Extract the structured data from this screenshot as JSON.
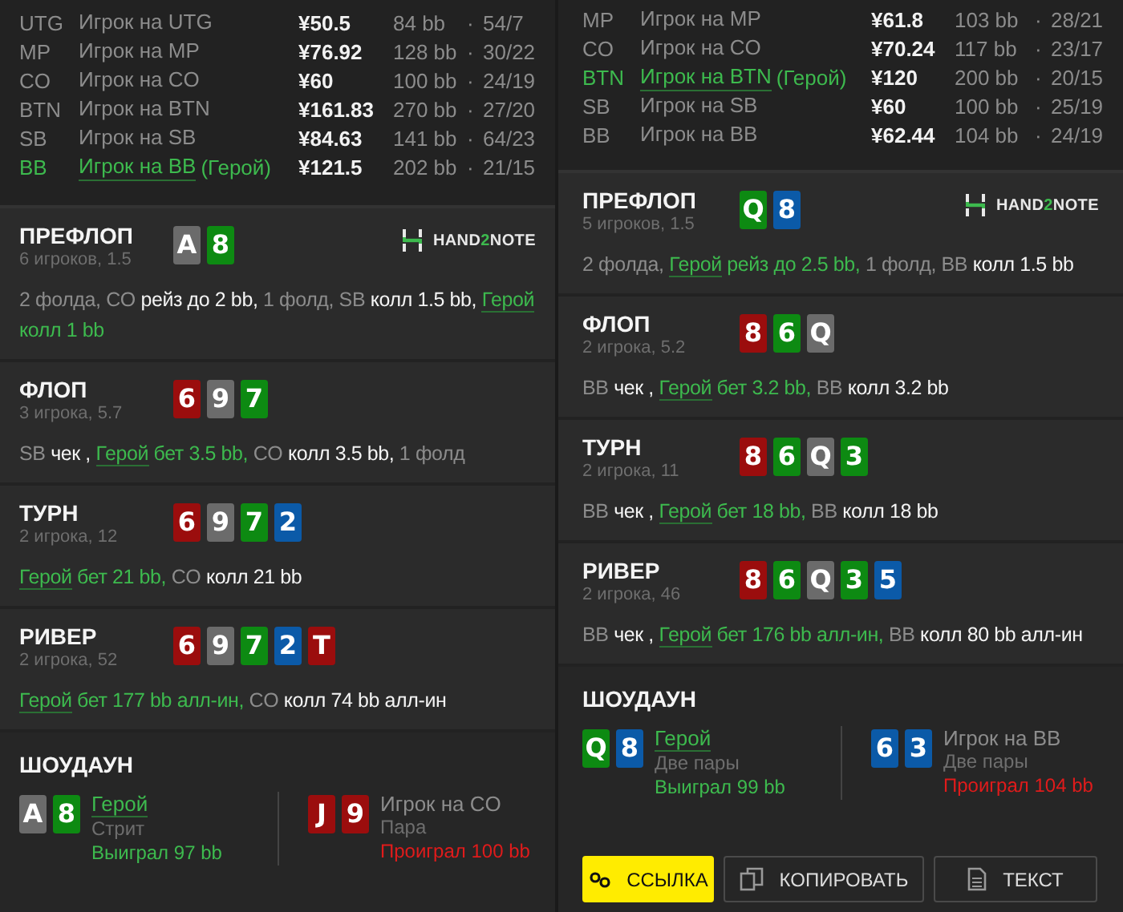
{
  "panels": [
    {
      "players": [
        {
          "pos": "UTG",
          "name": "Игрок на UTG",
          "hero": false,
          "stack": "¥50.5",
          "bb": "84 bb",
          "dot": "·",
          "stats": "54/7"
        },
        {
          "pos": "MP",
          "name": "Игрок на MP",
          "hero": false,
          "stack": "¥76.92",
          "bb": "128 bb",
          "dot": "·",
          "stats": "30/22"
        },
        {
          "pos": "CO",
          "name": "Игрок на CO",
          "hero": false,
          "stack": "¥60",
          "bb": "100 bb",
          "dot": "·",
          "stats": "24/19"
        },
        {
          "pos": "BTN",
          "name": "Игрок на BTN",
          "hero": false,
          "stack": "¥161.83",
          "bb": "270 bb",
          "dot": "·",
          "stats": "27/20"
        },
        {
          "pos": "SB",
          "name": "Игрок на SB",
          "hero": false,
          "stack": "¥84.63",
          "bb": "141 bb",
          "dot": "·",
          "stats": "64/23"
        },
        {
          "pos": "BB",
          "name": "Игрок на BB",
          "hero": true,
          "hero_tag": "(Герой)",
          "stack": "¥121.5",
          "bb": "202 bb",
          "dot": "·",
          "stats": "21/15"
        }
      ],
      "streets": [
        {
          "title": "ПРЕФЛОП",
          "sub": "6 игроков, 1.5",
          "logo": {
            "pre": "HAND",
            "mid": "2",
            "post": "NOTE"
          },
          "cards": [
            {
              "rank": "A",
              "color": "#6b6b6b"
            },
            {
              "rank": "8",
              "color": "#0d8a12"
            }
          ],
          "actions": [
            {
              "text": "2 фолда, CO ",
              "kind": "muted"
            },
            {
              "text": "рейз до 2 bb,",
              "kind": "strong"
            },
            {
              "text": " 1 фолд, SB ",
              "kind": "muted"
            },
            {
              "text": "колл 1.5 bb, ",
              "kind": "strong"
            },
            {
              "text": "Герой",
              "kind": "hero"
            },
            {
              "text": " колл 1 bb",
              "kind": "heroact"
            }
          ]
        },
        {
          "title": "ФЛОП",
          "sub": "3 игрока, 5.7",
          "cards": [
            {
              "rank": "6",
              "color": "#9b0d0d"
            },
            {
              "rank": "9",
              "color": "#6b6b6b"
            },
            {
              "rank": "7",
              "color": "#0d8a12"
            }
          ],
          "actions": [
            {
              "text": "SB ",
              "kind": "muted"
            },
            {
              "text": "чек , ",
              "kind": "strong"
            },
            {
              "text": "Герой",
              "kind": "hero"
            },
            {
              "text": " бет 3.5 bb,",
              "kind": "heroact"
            },
            {
              "text": " CO ",
              "kind": "muted"
            },
            {
              "text": "колл 3.5 bb,",
              "kind": "strong"
            },
            {
              "text": " 1 фолд",
              "kind": "muted"
            }
          ]
        },
        {
          "title": "ТУРН",
          "sub": "2 игрока, 12",
          "cards": [
            {
              "rank": "6",
              "color": "#9b0d0d"
            },
            {
              "rank": "9",
              "color": "#6b6b6b"
            },
            {
              "rank": "7",
              "color": "#0d8a12"
            },
            {
              "rank": "2",
              "color": "#0b5aa8"
            }
          ],
          "actions": [
            {
              "text": "Герой",
              "kind": "hero"
            },
            {
              "text": " бет 21 bb,",
              "kind": "heroact"
            },
            {
              "text": " CO ",
              "kind": "muted"
            },
            {
              "text": "колл 21 bb",
              "kind": "strong"
            }
          ]
        },
        {
          "title": "РИВЕР",
          "sub": "2 игрока, 52",
          "cards": [
            {
              "rank": "6",
              "color": "#9b0d0d"
            },
            {
              "rank": "9",
              "color": "#6b6b6b"
            },
            {
              "rank": "7",
              "color": "#0d8a12"
            },
            {
              "rank": "2",
              "color": "#0b5aa8"
            },
            {
              "rank": "T",
              "color": "#9b0d0d"
            }
          ],
          "actions": [
            {
              "text": "Герой",
              "kind": "hero"
            },
            {
              "text": " бет 177 bb алл-ин,",
              "kind": "heroact"
            },
            {
              "text": " CO ",
              "kind": "muted"
            },
            {
              "text": "колл 74 bb алл-ин",
              "kind": "strong"
            }
          ]
        }
      ],
      "showdown": {
        "title": "ШОУДАУН",
        "entries": [
          {
            "cards": [
              {
                "rank": "A",
                "color": "#6b6b6b"
              },
              {
                "rank": "8",
                "color": "#0d8a12"
              }
            ],
            "name": "Герой",
            "hero": true,
            "hand": "Стрит",
            "result": "Выиграл 97 bb",
            "won": true
          },
          {
            "cards": [
              {
                "rank": "J",
                "color": "#9b0d0d"
              },
              {
                "rank": "9",
                "color": "#9b0d0d"
              }
            ],
            "name": "Игрок на CO",
            "hero": false,
            "hand": "Пара",
            "result": "Проиграл 100 bb",
            "won": false
          }
        ]
      }
    },
    {
      "players": [
        {
          "pos": "MP",
          "name": "Игрок на MP",
          "hero": false,
          "stack": "¥61.8",
          "bb": "103 bb",
          "dot": "·",
          "stats": "28/21"
        },
        {
          "pos": "CO",
          "name": "Игрок на CO",
          "hero": false,
          "stack": "¥70.24",
          "bb": "117 bb",
          "dot": "·",
          "stats": "23/17"
        },
        {
          "pos": "BTN",
          "name": "Игрок на BTN",
          "hero": true,
          "hero_tag": "(Герой)",
          "stack": "¥120",
          "bb": "200 bb",
          "dot": "·",
          "stats": "20/15"
        },
        {
          "pos": "SB",
          "name": "Игрок на SB",
          "hero": false,
          "stack": "¥60",
          "bb": "100 bb",
          "dot": "·",
          "stats": "25/19"
        },
        {
          "pos": "BB",
          "name": "Игрок на BB",
          "hero": false,
          "stack": "¥62.44",
          "bb": "104 bb",
          "dot": "·",
          "stats": "24/19"
        }
      ],
      "streets": [
        {
          "title": "ПРЕФЛОП",
          "sub": "5 игроков, 1.5",
          "logo": {
            "pre": "HAND",
            "mid": "2",
            "post": "NOTE"
          },
          "cards": [
            {
              "rank": "Q",
              "color": "#0d8a12"
            },
            {
              "rank": "8",
              "color": "#0b5aa8"
            }
          ],
          "actions": [
            {
              "text": "2 фолда, ",
              "kind": "muted"
            },
            {
              "text": "Герой",
              "kind": "hero"
            },
            {
              "text": " рейз до 2.5 bb,",
              "kind": "heroact"
            },
            {
              "text": " 1 фолд, BB ",
              "kind": "muted"
            },
            {
              "text": "колл 1.5 bb",
              "kind": "strong"
            }
          ]
        },
        {
          "title": "ФЛОП",
          "sub": "2 игрока, 5.2",
          "cards": [
            {
              "rank": "8",
              "color": "#9b0d0d"
            },
            {
              "rank": "6",
              "color": "#0d8a12"
            },
            {
              "rank": "Q",
              "color": "#6b6b6b"
            }
          ],
          "actions": [
            {
              "text": "BB ",
              "kind": "muted"
            },
            {
              "text": "чек , ",
              "kind": "strong"
            },
            {
              "text": "Герой",
              "kind": "hero"
            },
            {
              "text": " бет 3.2 bb,",
              "kind": "heroact"
            },
            {
              "text": " BB ",
              "kind": "muted"
            },
            {
              "text": "колл 3.2 bb",
              "kind": "strong"
            }
          ]
        },
        {
          "title": "ТУРН",
          "sub": "2 игрока, 11",
          "cards": [
            {
              "rank": "8",
              "color": "#9b0d0d"
            },
            {
              "rank": "6",
              "color": "#0d8a12"
            },
            {
              "rank": "Q",
              "color": "#6b6b6b"
            },
            {
              "rank": "3",
              "color": "#0d8a12"
            }
          ],
          "actions": [
            {
              "text": "BB ",
              "kind": "muted"
            },
            {
              "text": "чек , ",
              "kind": "strong"
            },
            {
              "text": "Герой",
              "kind": "hero"
            },
            {
              "text": " бет 18 bb,",
              "kind": "heroact"
            },
            {
              "text": " BB ",
              "kind": "muted"
            },
            {
              "text": "колл 18 bb",
              "kind": "strong"
            }
          ]
        },
        {
          "title": "РИВЕР",
          "sub": "2 игрока, 46",
          "cards": [
            {
              "rank": "8",
              "color": "#9b0d0d"
            },
            {
              "rank": "6",
              "color": "#0d8a12"
            },
            {
              "rank": "Q",
              "color": "#6b6b6b"
            },
            {
              "rank": "3",
              "color": "#0d8a12"
            },
            {
              "rank": "5",
              "color": "#0b5aa8"
            }
          ],
          "actions": [
            {
              "text": "BB ",
              "kind": "muted"
            },
            {
              "text": "чек , ",
              "kind": "strong"
            },
            {
              "text": "Герой",
              "kind": "hero"
            },
            {
              "text": " бет 176 bb алл-ин,",
              "kind": "heroact"
            },
            {
              "text": " BB ",
              "kind": "muted"
            },
            {
              "text": "колл 80 bb алл-ин",
              "kind": "strong"
            }
          ]
        }
      ],
      "showdown": {
        "title": "ШОУДАУН",
        "entries": [
          {
            "cards": [
              {
                "rank": "Q",
                "color": "#0d8a12"
              },
              {
                "rank": "8",
                "color": "#0b5aa8"
              }
            ],
            "name": "Герой",
            "hero": true,
            "hand": "Две пары",
            "result": "Выиграл 99 bb",
            "won": true
          },
          {
            "cards": [
              {
                "rank": "6",
                "color": "#0b5aa8"
              },
              {
                "rank": "3",
                "color": "#0b5aa8"
              }
            ],
            "name": "Игрок на BB",
            "hero": false,
            "hand": "Две пары",
            "result": "Проиграл 104 bb",
            "won": false
          }
        ]
      },
      "buttons": [
        {
          "label": "ССЫЛКА",
          "kind": "link"
        },
        {
          "label": "КОПИРОВАТЬ",
          "kind": "copy"
        },
        {
          "label": "ТЕКСТ",
          "kind": "text"
        }
      ]
    }
  ]
}
